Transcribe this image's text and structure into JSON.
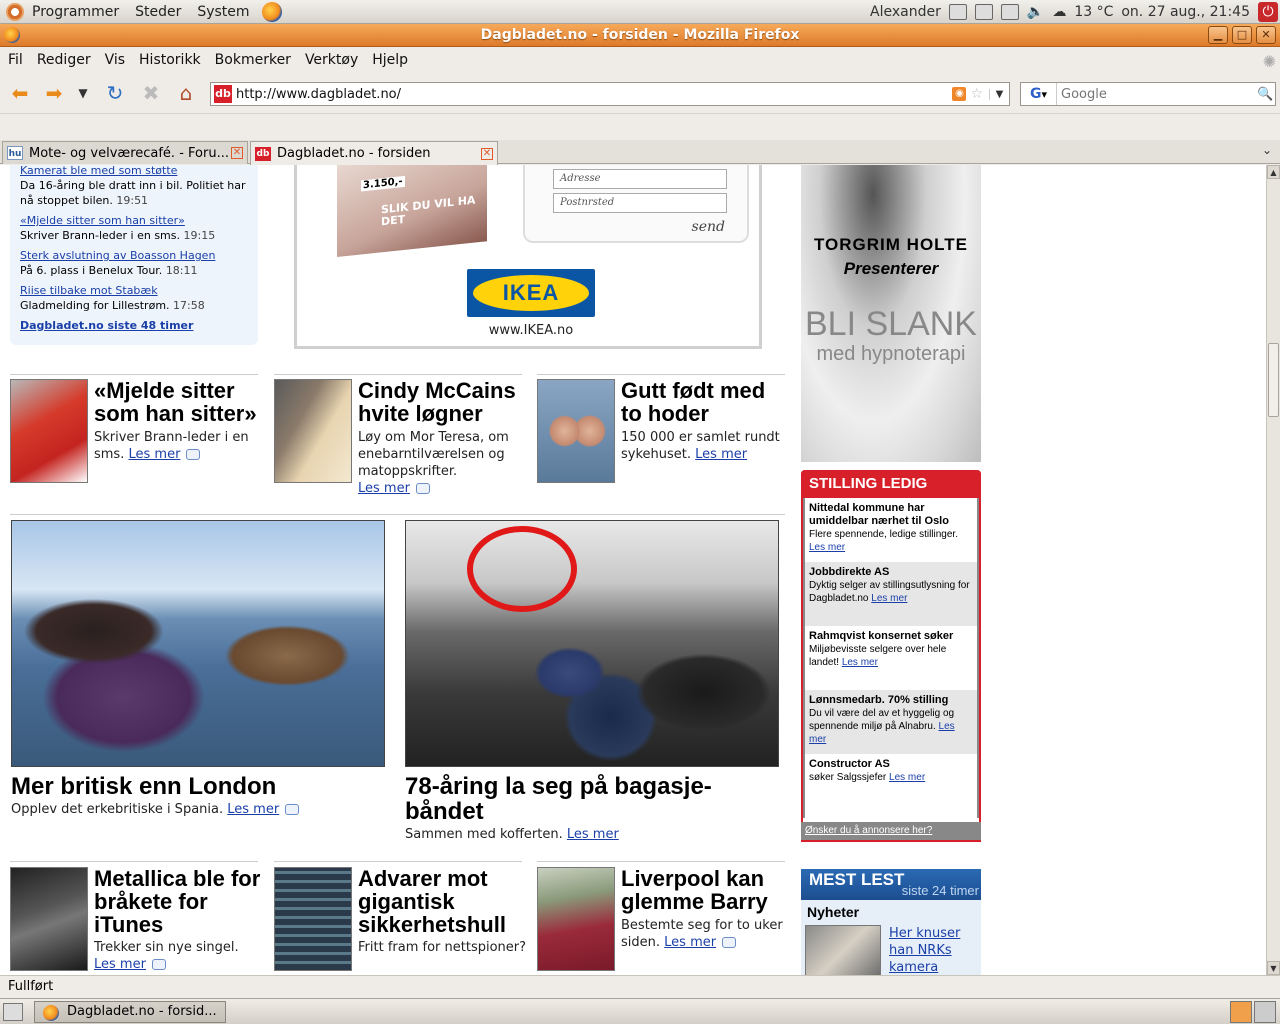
{
  "top_panel": {
    "menus": [
      "Programmer",
      "Steder",
      "System"
    ],
    "user": "Alexander",
    "weather": "13 °C",
    "clock": "on. 27 aug., 21:45"
  },
  "window": {
    "title": "Dagbladet.no - forsiden - Mozilla Firefox"
  },
  "menubar": [
    "Fil",
    "Rediger",
    "Vis",
    "Historikk",
    "Bokmerker",
    "Verktøy",
    "Hjelp"
  ],
  "navbar": {
    "url": "http://www.dagbladet.no/",
    "site_icon": "db",
    "search_placeholder": "Google"
  },
  "tabs": [
    {
      "label": "Mote- og velværecafé. - Foru...",
      "icon": "hu"
    },
    {
      "label": "Dagbladet.no - forsiden",
      "icon": "db"
    }
  ],
  "news_list": {
    "items": [
      {
        "title": "Kamerat ble med som støtte",
        "text": "Da 16-åring ble dratt inn i bil. Politiet har nå stoppet bilen.",
        "time": "19:51"
      },
      {
        "title": "«Mjelde sitter som han sitter»",
        "text": "Skriver Brann-leder i en sms.",
        "time": "19:15"
      },
      {
        "title": "Sterk avslutning av Boasson Hagen",
        "text": "På 6. plass i Benelux Tour.",
        "time": "18:11"
      },
      {
        "title": "Riise tilbake mot Stabæk",
        "text": "Gladmelding for Lillestrøm.",
        "time": "17:58"
      }
    ],
    "more": "Dagbladet.no siste 48 timer"
  },
  "ikea_ad": {
    "price": "3.150,-",
    "slogan": "SLIK DU VIL HA DET",
    "field_address": "Adresse",
    "field_postal": "Postnrsted",
    "send": "send",
    "logo": "IKEA",
    "url": "www.IKEA.no"
  },
  "articles_row1": [
    {
      "title": "«Mjelde sitter som han sitter»",
      "text": "Skriver Brann-leder i en sms.",
      "more": "Les mer"
    },
    {
      "title": "Cindy McCains hvite løgner",
      "text": "Løy om Mor Teresa, om enebarntilværelsen og matoppskrifter.",
      "more": "Les mer"
    },
    {
      "title": "Gutt født med to hoder",
      "text": "150 000 er samlet rundt sykehuset.",
      "more": "Les mer"
    }
  ],
  "big_articles": [
    {
      "title": "Mer britisk enn London",
      "text": "Opplev det erkebritiske i Spania.",
      "more": "Les mer"
    },
    {
      "title": "78-åring la seg på bagasje-båndet",
      "text": "Sammen med kofferten.",
      "more": "Les mer"
    }
  ],
  "articles_row2": [
    {
      "title": "Metallica ble for bråkete for iTunes",
      "text": "Trekker sin nye singel.",
      "more": "Les mer"
    },
    {
      "title": "Advarer mot gigantisk sikkerhetshull",
      "text": "Fritt fram for nettspioner?",
      "more": "Les mer"
    },
    {
      "title": "Liverpool kan glemme Barry",
      "text": "Bestemte seg for to uker siden.",
      "more": "Les mer"
    }
  ],
  "hyp_ad": {
    "line1": "TORGRIM HOLTE",
    "line2": "Presenterer",
    "line3": "BLI SLANK",
    "line4": "med hypnoterapi"
  },
  "stilling": {
    "header": "STILLING LEDIG",
    "jobs": [
      {
        "company": "Nittedal kommune har umiddelbar nærhet til Oslo",
        "text": "Flere spennende, ledige stillinger.",
        "more": "Les mer"
      },
      {
        "company": "Jobbdirekte AS",
        "text": "Dyktig selger av stillingsutlysning for Dagbladet.no",
        "more": "Les mer"
      },
      {
        "company": "Rahmqvist konsernet søker",
        "text": "Miljøbevisste selgere over hele landet!",
        "more": "Les mer"
      },
      {
        "company": "Lønnsmedarb. 70% stilling",
        "text": "Du vil være del av et hyggelig og spennende miljø på Alnabru.",
        "more": "Les mer"
      },
      {
        "company": "Constructor AS",
        "text": "søker Salgssjefer",
        "more": "Les mer"
      }
    ],
    "footer": "Ønsker du å annonsere her?"
  },
  "mest_lest": {
    "title": "MEST LEST",
    "subtitle": "siste 24 timer",
    "section": "Nyheter",
    "link": "Her knuser han NRKs kamera"
  },
  "statusbar": "Fullført",
  "taskbar": {
    "task": "Dagbladet.no - forsid..."
  },
  "colors": {
    "title_orange": "#dd7a2a",
    "dagbladet_red": "#d8202a",
    "link_blue": "#1a3fa8",
    "ikea_blue": "#0b56a4",
    "ikea_yellow": "#ffd20a"
  }
}
